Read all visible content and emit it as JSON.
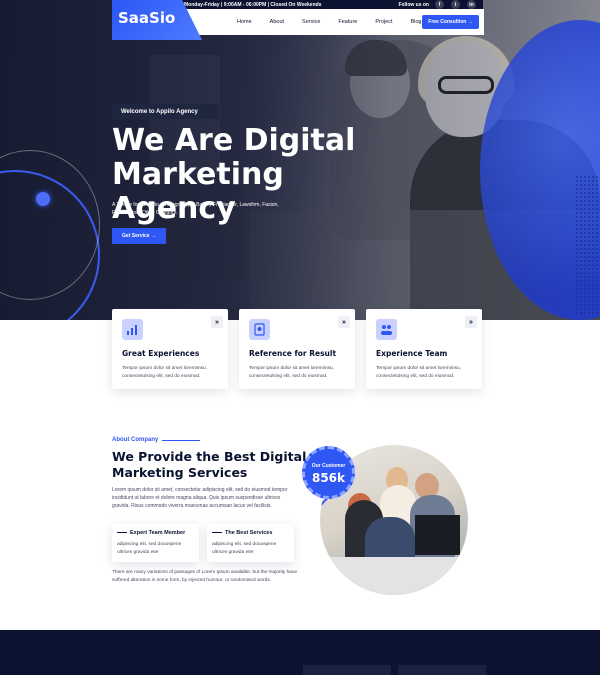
{
  "topbar": {
    "hours": "Monday-Friday | 9:00AM - 06:00PM | Closed On Weekends",
    "follow": "Follow us on",
    "social": [
      {
        "icon": "facebook-icon",
        "glyph": "f"
      },
      {
        "icon": "twitter-icon",
        "glyph": "t"
      },
      {
        "icon": "linkedin-icon",
        "glyph": "in"
      }
    ]
  },
  "brand": {
    "logo": "SaaSio",
    "color": "#2f57f3"
  },
  "nav": {
    "items": [
      "Home",
      "About",
      "Service",
      "Feature",
      "Project",
      "Blog"
    ],
    "cta": "Free Consultion",
    "cta_arrow": "→"
  },
  "hero": {
    "tag": "Welcome to Appilo Agency",
    "title": "We Are Digital Marketing Agency",
    "description": "A Theme for Portfolio, Photography & Bakery Freelancer, Lawsfirm, Fasion, Retails Store Other Category.",
    "button": "Get Service",
    "button_arrow": "→"
  },
  "features": [
    {
      "icon": "growth-chart-icon",
      "title": "Great Experiences",
      "text": "Tempor ipsum dolor sit amet loremimsu, consectetulsing elit, sed do eiusmod.",
      "arrow": "»"
    },
    {
      "icon": "certificate-icon",
      "title": "Reference for Result",
      "text": "Tempor ipsum dolor sit amet loremimsu, consectetulsing elit, sed do eiusmod.",
      "arrow": "»"
    },
    {
      "icon": "team-icon",
      "title": "Experience Team",
      "text": "Tempor ipsum dolor sit amet loremimsu, consectetulsing elit, sed do eiusmod.",
      "arrow": "»"
    }
  ],
  "about": {
    "tag": "About Company",
    "title": "We Provide the Best Digital Marketing Services",
    "text": "Lorem ipsum dolor sit amet, consectetur adipiscing elit, sed do eiusmod tempor incididunt ut labore et dolore magna aliqua. Quis ipsum suspendisse ultrices gravida. Risus commodo viverra maecenas accumsan lacus vel facilisis.",
    "points": [
      {
        "title": "Expert Team Member",
        "text": "adipiscing elit, sed douuspene ultrices gravida eter"
      },
      {
        "title": "The Best Services",
        "text": "adipiscing elit, sed douuspene ultrices gravida eter"
      }
    ],
    "footer_text": "There are many variations of passages of Lorem Ipsum available, but the majority have suffered alteration in some form, by injected humour, or randomised words.",
    "badge": {
      "label": "Our Customer",
      "value": "856k"
    }
  }
}
